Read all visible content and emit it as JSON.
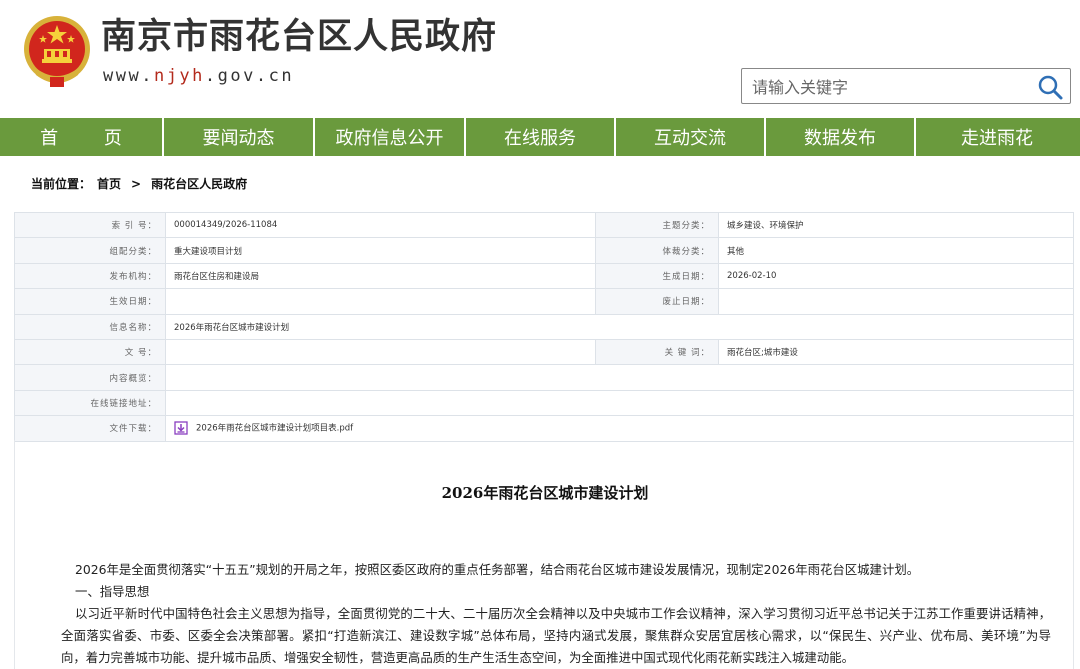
{
  "header": {
    "site_title": "南京市雨花台区人民政府",
    "url_prefix": "www.",
    "url_domain": "njyh",
    "url_suffix": ".gov.cn",
    "search_placeholder": "请输入关键字",
    "emblem_icon": "national-emblem-icon",
    "search_icon": "search-icon"
  },
  "nav": {
    "items": [
      "首 页",
      "要闻动态",
      "政府信息公开",
      "在线服务",
      "互动交流",
      "数据发布",
      "走进雨花"
    ],
    "color": "#6a9a3d"
  },
  "breadcrumb": {
    "label": "当前位置：",
    "home": "首页",
    "separator": ">",
    "current": "雨花台区人民政府"
  },
  "info": {
    "index_label": "索 引 号：",
    "index_value": "000014349/2026-11084",
    "topic_label": "主题分类：",
    "topic_value": "城乡建设、环境保护",
    "category_label": "组配分类：",
    "category_value": "重大建设项目计划",
    "genre_label": "体裁分类：",
    "genre_value": "其他",
    "publisher_label": "发布机构：",
    "publisher_value": "雨花台区住房和建设局",
    "created_label": "生成日期：",
    "created_value": "2026-02-10",
    "effective_label": "生效日期：",
    "effective_value": "",
    "abolished_label": "废止日期：",
    "abolished_value": "",
    "name_label": "信息名称：",
    "name_value": "2026年雨花台区城市建设计划",
    "docno_label": "文 号：",
    "docno_value": "",
    "keywords_label": "关 键 词：",
    "keywords_value": "雨花台区;城市建设",
    "summary_label": "内容概览：",
    "summary_value": "",
    "link_label": "在线链接地址：",
    "link_value": "",
    "download_label": "文件下载：",
    "download_value": "2026年雨花台区城市建设计划项目表.pdf",
    "download_icon": "download-file-icon"
  },
  "article": {
    "title": "2026年雨花台区城市建设计划",
    "intro": "2026年是全面贯彻落实“十五五”规划的开局之年，按照区委区政府的重点任务部署，结合雨花台区城市建设发展情况，现制定2026年雨花台区城建计划。",
    "heading1": "一、指导思想",
    "body1": "以习近平新时代中国特色社会主义思想为指导，全面贯彻党的二十大、二十届历次全会精神以及中央城市工作会议精神，深入学习贯彻习近平总书记关于江苏工作重要讲话精神，全面落实省委、市委、区委全会决策部署。紧扣“打造新滨江、建设数字城”总体布局，坚持内涵式发展，聚焦群众安居宜居核心需求，以“保民生、兴产业、优布局、美环境”为导向，着力完善城市功能、提升城市品质、增强安全韧性，营造更高品质的生产生活生态空间，为全面推进中国式现代化雨花新实践注入城建动能。"
  }
}
